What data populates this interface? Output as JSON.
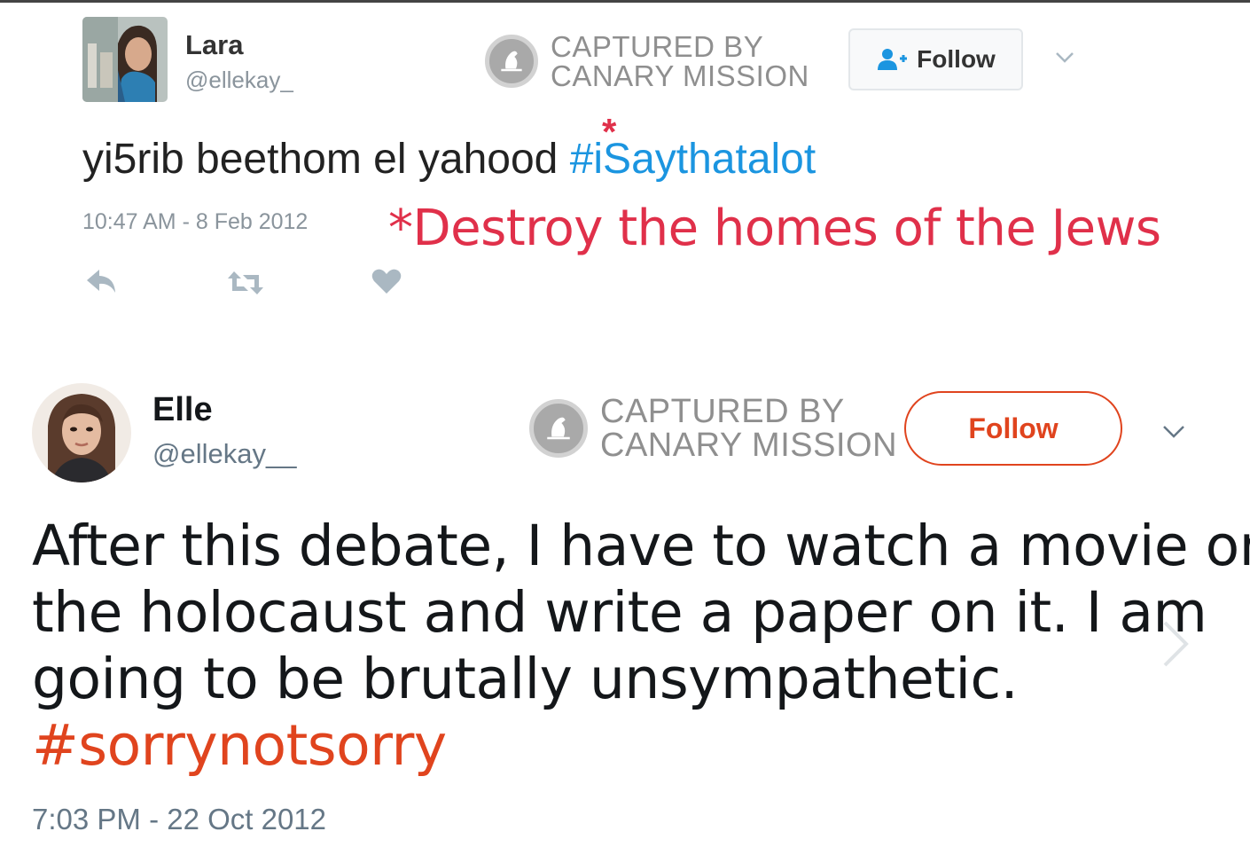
{
  "tweet1": {
    "name": "Lara",
    "handle": "@ellekay_",
    "follow_label": "Follow",
    "text": "yi5rib beethom el yahood",
    "asterisk": "*",
    "hashtag": "#iSaythatalot",
    "timestamp": "10:47 AM - 8 Feb 2012",
    "translation": "*Destroy the homes of the Jews",
    "actions": [
      "reply-icon",
      "retweet-icon",
      "like-icon"
    ]
  },
  "watermark": {
    "line1": "CAPTURED BY",
    "line2": "CANARY MISSION"
  },
  "tweet2": {
    "name": "Elle",
    "handle": "@ellekay__",
    "follow_label": "Follow",
    "lines": [
      "After this debate, I have to watch a movie on",
      "the holocaust and write a paper on it. I am",
      "going to be brutally unsympathetic."
    ],
    "hashtag": "#sorrynotsorry",
    "timestamp": "7:03 PM - 22 Oct 2012"
  },
  "colors": {
    "link_blue": "#1b95e0",
    "annotation_red": "#e0304a",
    "orange_accent": "#e0441e",
    "watermark_gray": "#8f8f8f"
  }
}
